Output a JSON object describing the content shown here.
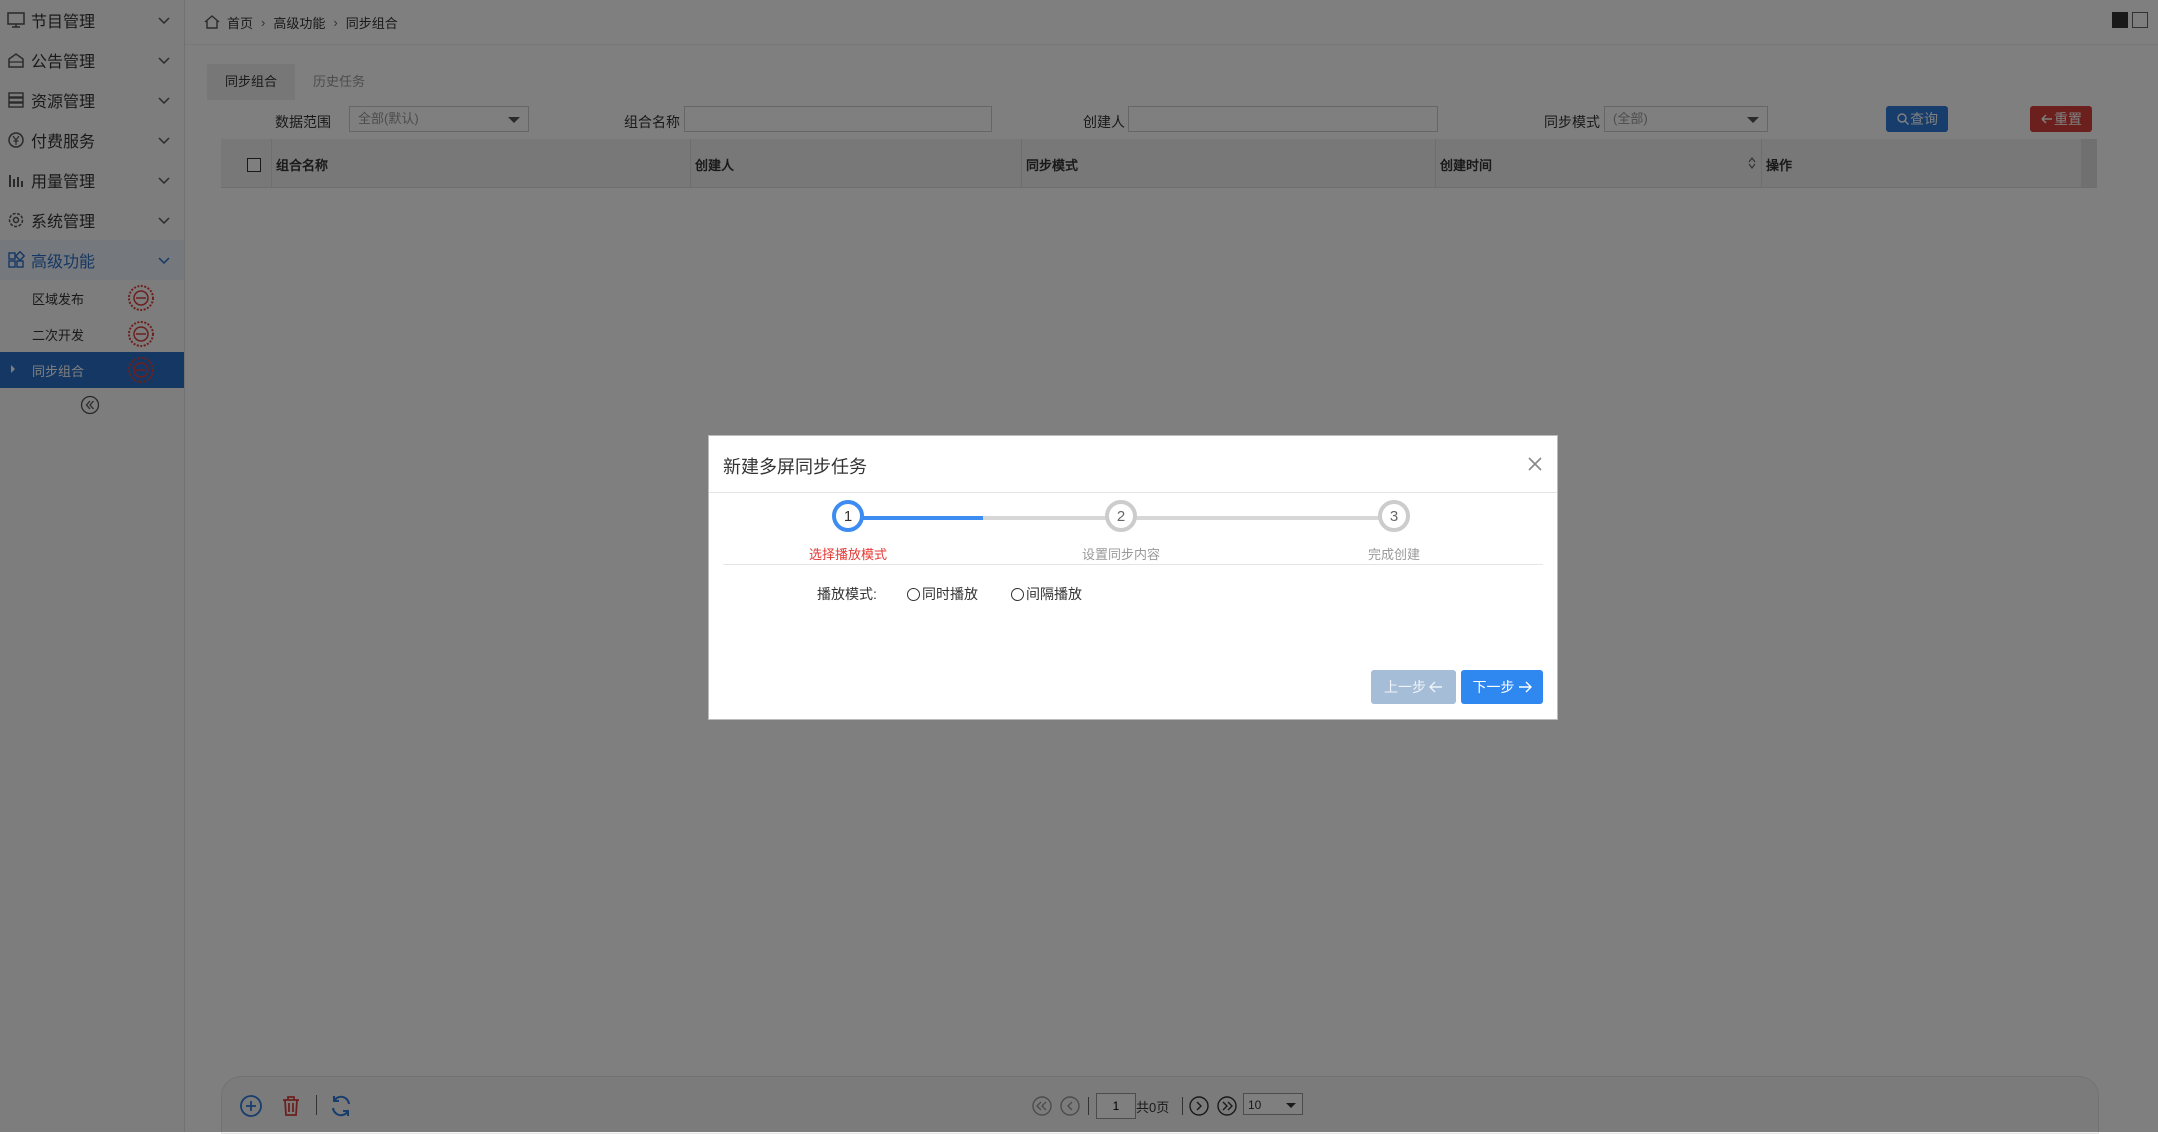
{
  "sidebar": {
    "items": [
      {
        "label": "节目管理",
        "icon": "monitor-icon"
      },
      {
        "label": "公告管理",
        "icon": "bulletin-icon"
      },
      {
        "label": "资源管理",
        "icon": "storage-icon"
      },
      {
        "label": "付费服务",
        "icon": "payment-icon"
      },
      {
        "label": "用量管理",
        "icon": "bar-chart-icon"
      },
      {
        "label": "系统管理",
        "icon": "gear-icon"
      },
      {
        "label": "高级功能",
        "icon": "apps-icon"
      }
    ],
    "sub_items": [
      {
        "label": "区域发布"
      },
      {
        "label": "二次开发"
      },
      {
        "label": "同步组合"
      }
    ]
  },
  "breadcrumb": {
    "home": "首页",
    "level1": "高级功能",
    "current": "同步组合"
  },
  "tabs": [
    {
      "label": "同步组合"
    },
    {
      "label": "历史任务"
    }
  ],
  "filters": {
    "scope_label": "数据范围",
    "scope_value": "全部(默认)",
    "name_label": "组合名称",
    "name_value": "",
    "creator_label": "创建人",
    "creator_value": "",
    "mode_label": "同步模式",
    "mode_value": "(全部)",
    "query_label": "查询",
    "reset_label": "重置"
  },
  "grid": {
    "columns": [
      "组合名称",
      "创建人",
      "同步模式",
      "创建时间",
      "操作"
    ]
  },
  "pager": {
    "page_input": "1",
    "total_text": "共0页",
    "page_size": "10"
  },
  "modal": {
    "title": "新建多屏同步任务",
    "steps": [
      {
        "num": "1",
        "label": "选择播放模式"
      },
      {
        "num": "2",
        "label": "设置同步内容"
      },
      {
        "num": "3",
        "label": "完成创建"
      }
    ],
    "mode_label": "播放模式:",
    "options": [
      "同时播放",
      "间隔播放"
    ],
    "prev_label": "上一步",
    "next_label": "下一步"
  },
  "colors": {
    "primary": "#2f87f0",
    "danger": "#d9413b",
    "step_active_text": "#e53935"
  }
}
